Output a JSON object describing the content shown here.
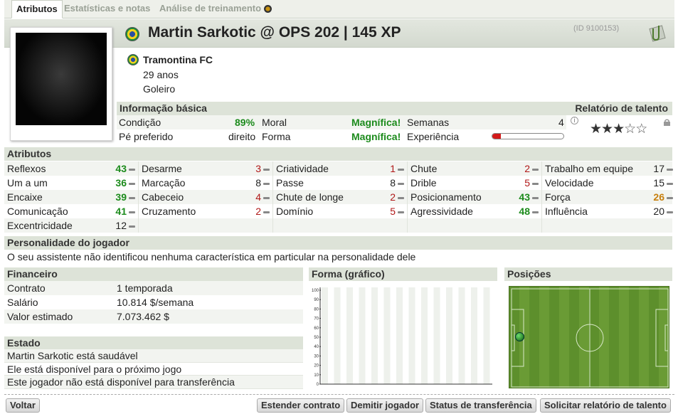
{
  "tabs": [
    "Atributos",
    "Estatísticas e notas",
    "Análise de treinamento"
  ],
  "header": {
    "title": "Martin Sarkotic @ OPS 202 | 145 XP",
    "id": "(ID 9100153)"
  },
  "player": {
    "club": "Tramontina FC",
    "age": "29 anos",
    "position": "Goleiro"
  },
  "basic": {
    "title": "Informação básica",
    "talent_title": "Relatório de talento",
    "condition_label": "Condição",
    "condition": "89%",
    "foot_label": "Pé preferido",
    "foot": "direito",
    "moral_label": "Moral",
    "moral": "Magnífica!",
    "form_label": "Forma",
    "form": "Magnífica!",
    "weeks_label": "Semanas",
    "weeks": "4",
    "exp_label": "Experiência",
    "experience": 0.12,
    "talent_stars": 3,
    "talent_max": 5
  },
  "attributes": {
    "title": "Atributos",
    "col1": [
      {
        "n": "Reflexos",
        "v": "43",
        "c": "grn"
      },
      {
        "n": "Um a um",
        "v": "36",
        "c": "grn"
      },
      {
        "n": "Encaixe",
        "v": "39",
        "c": "grn"
      },
      {
        "n": "Comunicação",
        "v": "41",
        "c": "grn"
      },
      {
        "n": "Excentricidade",
        "v": "12",
        "c": ""
      }
    ],
    "col2": [
      {
        "n": "Desarme",
        "v": "3",
        "c": "red"
      },
      {
        "n": "Marcação",
        "v": "8",
        "c": ""
      },
      {
        "n": "Cabeceio",
        "v": "4",
        "c": "red"
      },
      {
        "n": "Cruzamento",
        "v": "2",
        "c": "red"
      }
    ],
    "col3": [
      {
        "n": "Criatividade",
        "v": "1",
        "c": "red"
      },
      {
        "n": "Passe",
        "v": "8",
        "c": ""
      },
      {
        "n": "Chute de longe",
        "v": "2",
        "c": "red"
      },
      {
        "n": "Domínio",
        "v": "5",
        "c": "red"
      }
    ],
    "col4": [
      {
        "n": "Chute",
        "v": "2",
        "c": "red"
      },
      {
        "n": "Drible",
        "v": "5",
        "c": "red"
      },
      {
        "n": "Posicionamento",
        "v": "43",
        "c": "grn"
      },
      {
        "n": "Agressividade",
        "v": "48",
        "c": "grn"
      }
    ],
    "col5": [
      {
        "n": "Trabalho em equipe",
        "v": "17",
        "c": ""
      },
      {
        "n": "Velocidade",
        "v": "15",
        "c": ""
      },
      {
        "n": "Força",
        "v": "26",
        "c": "org"
      },
      {
        "n": "Influência",
        "v": "20",
        "c": ""
      }
    ]
  },
  "personality": {
    "title": "Personalidade do jogador",
    "text": "O seu assistente não identificou nenhuma característica em particular na personalidade dele"
  },
  "finance": {
    "title": "Financeiro",
    "rows": [
      {
        "l": "Contrato",
        "v": "1 temporada"
      },
      {
        "l": "Salário",
        "v": "10.814 $/semana"
      },
      {
        "l": "Valor estimado",
        "v": "7.073.462 $"
      }
    ]
  },
  "status": {
    "title": "Estado",
    "lines": [
      "Martin Sarkotic está saudável",
      "Ele está disponível para o próximo jogo",
      "Este jogador não está disponível para transferência"
    ]
  },
  "form_chart": {
    "title": "Forma (gráfico)"
  },
  "positions": {
    "title": "Posições"
  },
  "buttons": {
    "back": "Voltar",
    "extend": "Estender contrato",
    "fire": "Demitir jogador",
    "transfer": "Status de transferência",
    "talent": "Solicitar relatório de talento"
  },
  "chart_data": {
    "type": "line",
    "title": "Forma (gráfico)",
    "yticks": [
      "100",
      "90",
      "80",
      "70",
      "60",
      "50",
      "40",
      "30",
      "20",
      "10",
      "0"
    ],
    "ylim": [
      0,
      100
    ],
    "series": []
  }
}
